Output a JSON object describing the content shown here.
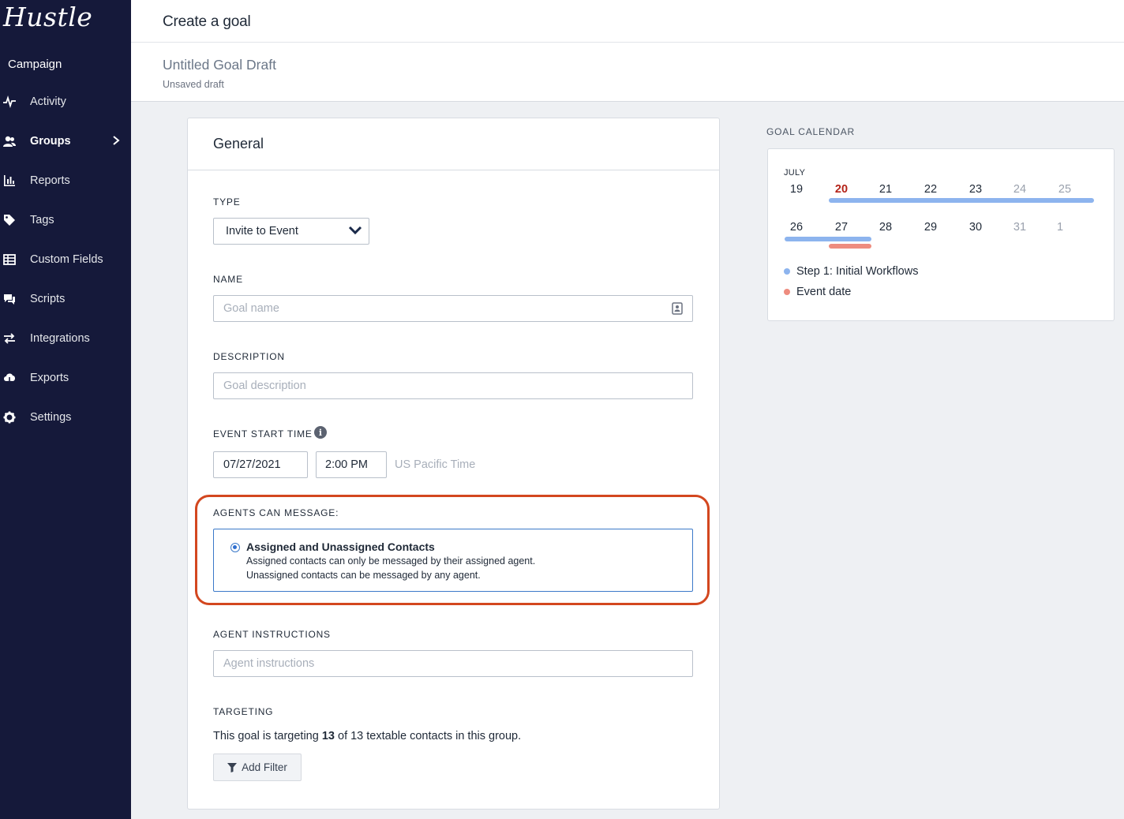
{
  "app": {
    "logo": "Hustle"
  },
  "sidebar": {
    "section": "Campaign",
    "items": [
      {
        "label": "Activity",
        "icon": "activity-icon"
      },
      {
        "label": "Groups",
        "icon": "groups-icon",
        "active": true
      },
      {
        "label": "Reports",
        "icon": "reports-icon"
      },
      {
        "label": "Tags",
        "icon": "tag-icon"
      },
      {
        "label": "Custom Fields",
        "icon": "custom-fields-icon"
      },
      {
        "label": "Scripts",
        "icon": "scripts-icon"
      },
      {
        "label": "Integrations",
        "icon": "integrations-icon"
      },
      {
        "label": "Exports",
        "icon": "exports-icon"
      },
      {
        "label": "Settings",
        "icon": "gear-icon"
      }
    ]
  },
  "header": {
    "title": "Create a goal"
  },
  "draft": {
    "title": "Untitled Goal Draft",
    "status": "Unsaved draft"
  },
  "general": {
    "title": "General",
    "type": {
      "label": "TYPE",
      "value": "Invite to Event"
    },
    "name": {
      "label": "NAME",
      "placeholder": "Goal name"
    },
    "description": {
      "label": "DESCRIPTION",
      "placeholder": "Goal description"
    },
    "event_start": {
      "label": "EVENT START TIME",
      "date": "07/27/2021",
      "time": "2:00 PM",
      "timezone": "US Pacific Time"
    },
    "agents_can_message": {
      "label": "AGENTS CAN MESSAGE:",
      "option_title": "Assigned and Unassigned Contacts",
      "option_line1": "Assigned contacts can only be messaged by their assigned agent.",
      "option_line2": "Unassigned contacts can be messaged by any agent."
    },
    "agent_instructions": {
      "label": "AGENT INSTRUCTIONS",
      "placeholder": "Agent instructions"
    },
    "targeting": {
      "label": "TARGETING",
      "prefix": "This goal is targeting",
      "count": "13",
      "suffix": "of 13 textable contacts in this group.",
      "filter_button": "Add Filter"
    }
  },
  "calendar": {
    "label": "GOAL CALENDAR",
    "month": "JULY",
    "week1": [
      "19",
      "20",
      "21",
      "22",
      "23",
      "24",
      "25"
    ],
    "week2": [
      "26",
      "27",
      "28",
      "29",
      "30",
      "31",
      "1"
    ],
    "legend": [
      {
        "label": "Step 1: Initial Workflows",
        "color": "#8db4ee"
      },
      {
        "label": "Event date",
        "color": "#ee8c7f"
      }
    ],
    "today_color": "#b42318"
  },
  "colors": {
    "sidebar": "#15193a",
    "highlight": "#d3471f",
    "accent": "#3b79c9"
  }
}
